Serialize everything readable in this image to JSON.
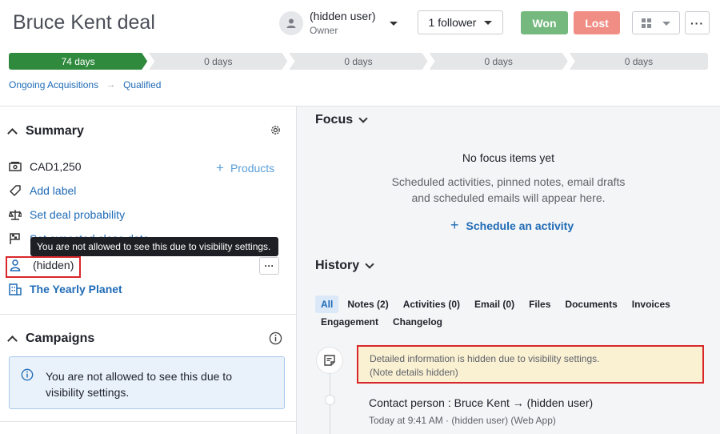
{
  "header": {
    "title": "Bruce Kent deal",
    "owner_name": "(hidden user)",
    "owner_role": "Owner",
    "follower_label": "1 follower",
    "won_label": "Won",
    "lost_label": "Lost",
    "more_label": "···"
  },
  "stages": [
    {
      "label": "74 days",
      "active": true
    },
    {
      "label": "0 days",
      "active": false
    },
    {
      "label": "0 days",
      "active": false
    },
    {
      "label": "0 days",
      "active": false
    },
    {
      "label": "0 days",
      "active": false
    }
  ],
  "breadcrumb": {
    "pipeline": "Ongoing Acquisitions",
    "arrow": "→",
    "stage": "Qualified"
  },
  "summary": {
    "title": "Summary",
    "value": "CAD1,250",
    "products_label": "Products",
    "add_label": "Add label",
    "set_probability": "Set deal probability",
    "expected_close_partial": "Set expected close date",
    "tooltip": "You are not allowed to see this due to visibility settings.",
    "person": "(hidden)",
    "organization": "The Yearly Planet",
    "dots_label": "···"
  },
  "campaigns": {
    "title": "Campaigns",
    "notice": "You are not allowed to see this due to visibility settings."
  },
  "focus": {
    "title": "Focus",
    "empty_title": "No focus items yet",
    "empty_desc_line1": "Scheduled activities, pinned notes, email drafts",
    "empty_desc_line2": "and scheduled emails will appear here.",
    "schedule_label": "Schedule an activity"
  },
  "history": {
    "title": "History",
    "tabs": [
      "All",
      "Notes (2)",
      "Activities (0)",
      "Email (0)",
      "Files",
      "Documents",
      "Invoices",
      "Engagement",
      "Changelog"
    ],
    "hidden_line1": "Detailed information is hidden due to visibility settings.",
    "hidden_line2": "(Note details hidden)",
    "contact_change": "Contact person : Bruce Kent → (hidden user)",
    "contact_meta": "Today at 9:41 AM · (hidden user) (Web App)"
  },
  "colors": {
    "accent": "#1f6bb6",
    "won": "#76b97e",
    "lost": "#f08d84",
    "stage_active": "#2f8a3d",
    "highlight_border": "#d9262a"
  }
}
